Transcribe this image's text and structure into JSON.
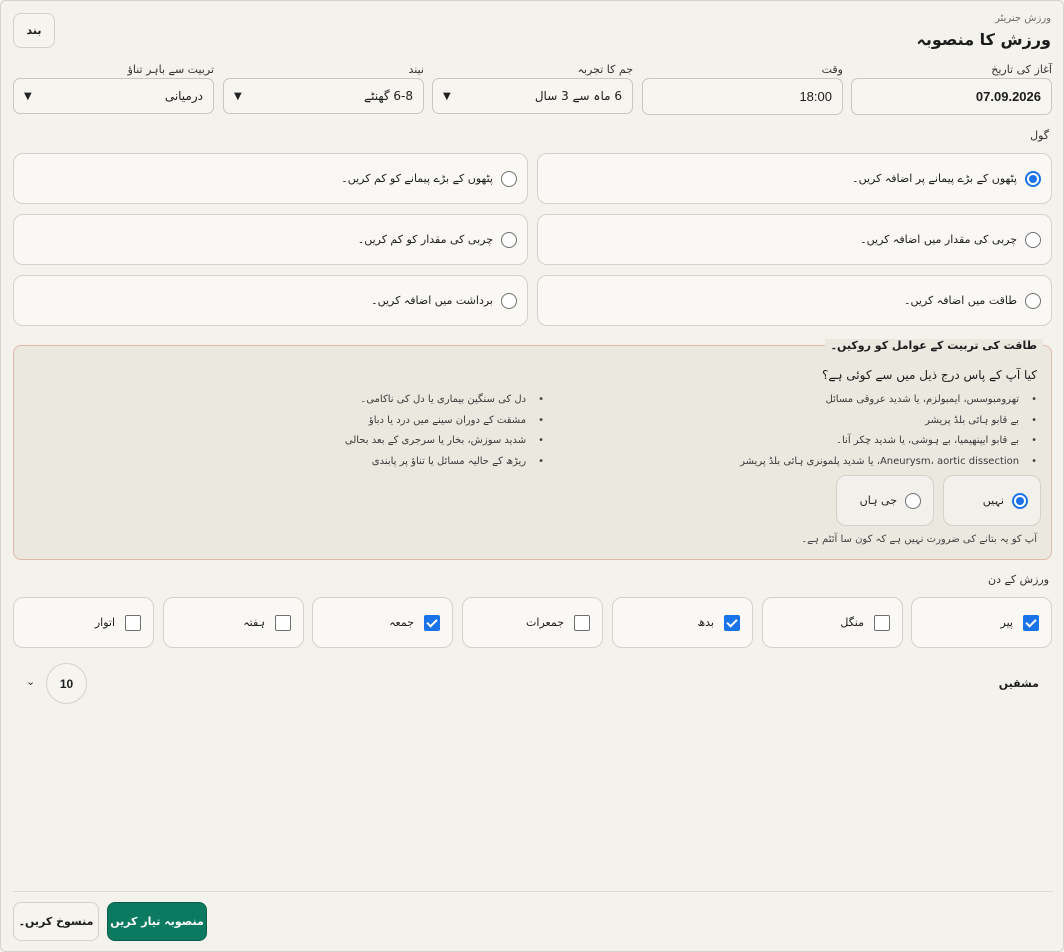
{
  "header": {
    "subtitle": "ورزش جنریٹر",
    "title": "ورزش کا منصوبہ",
    "close_label": "بند"
  },
  "fields": {
    "start_date": {
      "label": "آغاز کی تاریخ",
      "value": "07.09.2026"
    },
    "time": {
      "label": "وقت",
      "value": "18:00"
    },
    "gym_experience": {
      "label": "جم کا تجربہ",
      "value": "6 ماہ سے 3 سال"
    },
    "sleep": {
      "label": "نیند",
      "value": "6-8 گھنٹے"
    },
    "outside_stress": {
      "label": "تربیت سے باہر تناؤ",
      "value": "درمیانی"
    }
  },
  "goals": {
    "label": "گول",
    "items": [
      {
        "label": "پٹھوں کے بڑے پیمانے پر اضافہ کریں۔",
        "selected": true
      },
      {
        "label": "پٹھوں کے بڑے پیمانے کو کم کریں۔",
        "selected": false
      },
      {
        "label": "چربی کی مقدار میں اضافہ کریں۔",
        "selected": false
      },
      {
        "label": "چربی کی مقدار کو کم کریں۔",
        "selected": false
      },
      {
        "label": "طاقت میں اضافہ کریں۔",
        "selected": false
      },
      {
        "label": "برداشت میں اضافہ کریں۔",
        "selected": false
      }
    ]
  },
  "contraindications": {
    "title": "طاقت کی تربیت کے عوامل کو روکیں۔",
    "question": "کیا آپ کے پاس درج ذیل میں سے کوئی ہے؟",
    "list_right": [
      "تھرومبوسس، ایمبولزم، یا شدید عروقی مسائل",
      "بے قابو ہائی بلڈ پریشر",
      "بے قابو ایپنھیمیا، بے ہوشی، یا شدید چکر آنا۔",
      "Aneurysm، aortic dissection، یا شدید پلمونری ہائی بلڈ پریشر"
    ],
    "list_left": [
      "دل کی سنگین بیماری یا دل کی ناکامی۔",
      "مشقت کے دوران سینے میں درد یا دباؤ",
      "شدید سوزش، بخار یا سرجری کے بعد بحالی",
      "ریڑھ کے حالیہ مسائل یا تناؤ پر پابندی"
    ],
    "no_label": "نہیں",
    "yes_label": "جی ہاں",
    "selected": "no",
    "note": "آپ کو یہ بتانے کی ضرورت نہیں ہے کہ کون سا آئٹم ہے۔"
  },
  "days": {
    "label": "ورزش کے دن",
    "items": [
      {
        "label": "پیر",
        "checked": true
      },
      {
        "label": "منگل",
        "checked": false
      },
      {
        "label": "بدھ",
        "checked": true
      },
      {
        "label": "جمعرات",
        "checked": false
      },
      {
        "label": "جمعہ",
        "checked": true
      },
      {
        "label": "ہفتہ",
        "checked": false
      },
      {
        "label": "اتوار",
        "checked": false
      }
    ]
  },
  "exercises": {
    "label": "مشقیں",
    "count": "10"
  },
  "footer": {
    "create_label": "منصوبہ تیار کریں",
    "cancel_label": "منسوخ کریں۔"
  },
  "colors": {
    "accent": "#1a73e8",
    "primary_button": "#0b7a60",
    "warning_border": "#e4b9ad"
  }
}
